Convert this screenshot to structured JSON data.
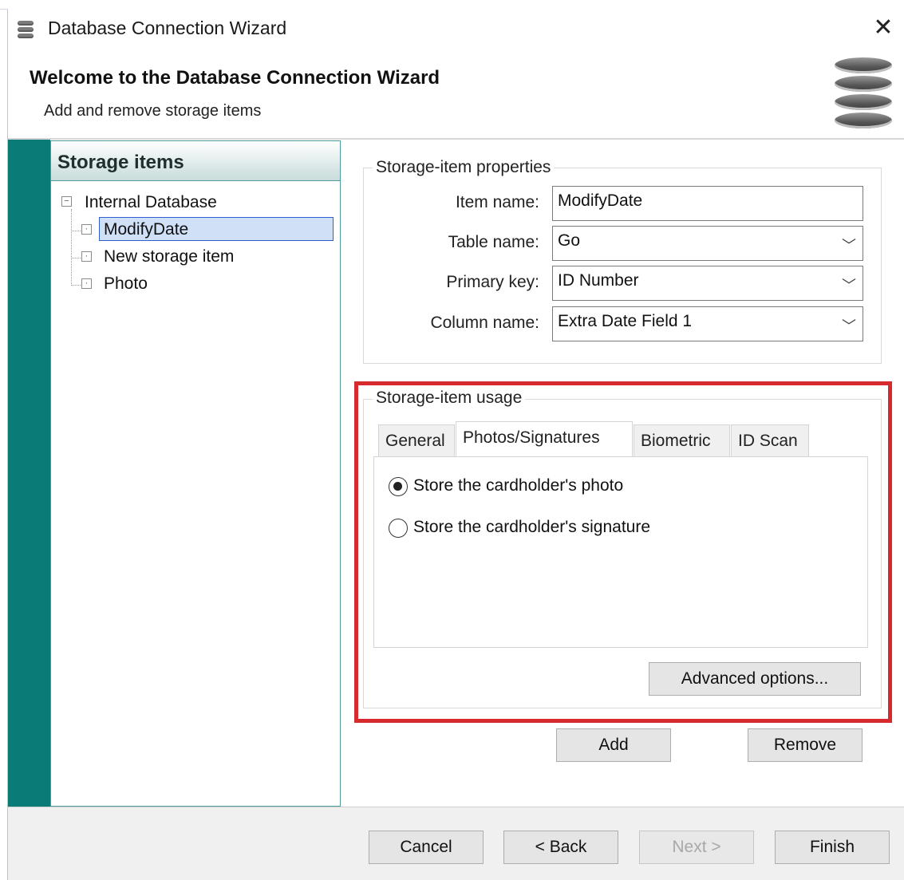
{
  "window": {
    "title": "Database Connection Wizard",
    "close_glyph": "✕",
    "icon": "database-icon"
  },
  "header": {
    "heading": "Welcome to the Database Connection Wizard",
    "subtitle": "Add and remove storage items",
    "icon": "database-stack-icon"
  },
  "storage_items": {
    "title": "Storage items",
    "root": {
      "label": "Internal Database",
      "expander": "−"
    },
    "items": [
      {
        "label": "ModifyDate",
        "selected": true
      },
      {
        "label": "New storage item",
        "selected": false
      },
      {
        "label": "Photo",
        "selected": false
      }
    ]
  },
  "properties": {
    "legend": "Storage-item properties",
    "item_name": {
      "label": "Item name:",
      "value": "ModifyDate"
    },
    "table_name": {
      "label": "Table name:",
      "value": "Go"
    },
    "primary_key": {
      "label": "Primary key:",
      "value": "ID Number"
    },
    "column_name": {
      "label": "Column name:",
      "value": "Extra Date Field 1"
    },
    "dropdown_glyph": "﹀"
  },
  "usage": {
    "legend": "Storage-item usage",
    "tabs": [
      {
        "label": "General",
        "active": false
      },
      {
        "label": "Photos/Signatures",
        "active": true
      },
      {
        "label": "Biometric",
        "active": false
      },
      {
        "label": "ID Scan",
        "active": false
      }
    ],
    "options": [
      {
        "label": "Store the cardholder's photo",
        "checked": true
      },
      {
        "label": "Store the cardholder's signature",
        "checked": false
      }
    ],
    "advanced_label": "Advanced options..."
  },
  "item_buttons": {
    "add": "Add",
    "remove": "Remove"
  },
  "footer": {
    "cancel": "Cancel",
    "back": "< Back",
    "next": "Next >",
    "finish": "Finish",
    "next_enabled": false
  },
  "colors": {
    "teal": "#0b7b78",
    "highlight": "#d62a2f",
    "selection": "#cfe0f7"
  }
}
